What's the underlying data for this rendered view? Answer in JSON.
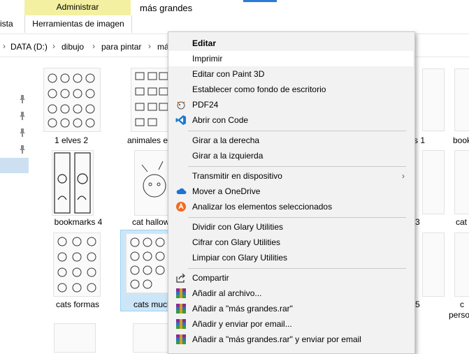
{
  "ribbon": {
    "admin_tab": "Administrar",
    "tools_tab": "Herramientas de imagen",
    "view_tab_partial": "ista",
    "window_title": "más grandes"
  },
  "address": {
    "crumbs": [
      "DATA (D:)",
      "dibujo",
      "para pintar",
      "má"
    ]
  },
  "files": [
    {
      "name": "1 elves 2"
    },
    {
      "name": "animales en"
    },
    {
      "name": "bookmarks 4"
    },
    {
      "name": "cat hallow"
    },
    {
      "name": "cats formas"
    },
    {
      "name": "cats much"
    }
  ],
  "right_partial": {
    "p1": "s 1",
    "p2": "book",
    "p3": "3",
    "p4": "cat",
    "p5": "5",
    "p6": "c",
    "p7": "perso"
  },
  "menu": {
    "items": [
      {
        "label": "Editar",
        "icon": "none"
      },
      {
        "label": "Imprimir",
        "icon": "none"
      },
      {
        "label": "Editar con Paint 3D",
        "icon": "none"
      },
      {
        "label": "Establecer como fondo de escritorio",
        "icon": "none"
      },
      {
        "label": "PDF24",
        "icon": "pdf24-sheep-icon"
      },
      {
        "label": "Abrir con Code",
        "icon": "vscode-icon"
      },
      {
        "label": "Girar a la derecha",
        "icon": "none"
      },
      {
        "label": "Girar a la izquierda",
        "icon": "none"
      },
      {
        "label": "Transmitir en dispositivo",
        "icon": "none"
      },
      {
        "label": "Mover a OneDrive",
        "icon": "onedrive-cloud-icon"
      },
      {
        "label": "Analizar los elementos seleccionados",
        "icon": "avast-icon"
      },
      {
        "label": "Dividir con Glary Utilities",
        "icon": "none"
      },
      {
        "label": "Cifrar con Glary Utilities",
        "icon": "none"
      },
      {
        "label": "Limpiar con Glary Utilities",
        "icon": "none"
      },
      {
        "label": "Compartir",
        "icon": "share-icon"
      },
      {
        "label": "Añadir al archivo...",
        "icon": "winrar-icon"
      },
      {
        "label": "Añadir a \"más grandes.rar\"",
        "icon": "winrar-icon"
      },
      {
        "label": "Añadir y enviar por email...",
        "icon": "winrar-icon"
      },
      {
        "label": "Añadir a \"más grandes.rar\" y enviar por email",
        "icon": "winrar-icon"
      }
    ],
    "hover_index": 1,
    "submenu_arrow": "›"
  },
  "colors": {
    "admin_tab_bg": "#f4f0a2",
    "selection_bg": "#cde6f7",
    "menu_bg": "#f2f2f2",
    "vscode_blue": "#1e7bd1",
    "onedrive_blue": "#1a73d9",
    "avast_orange": "#f26b1d"
  }
}
